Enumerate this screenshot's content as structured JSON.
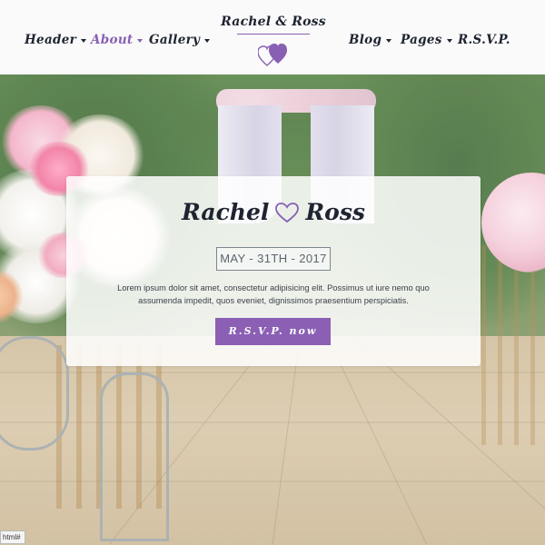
{
  "header": {
    "nav_left": [
      {
        "label": "Header",
        "active": false
      },
      {
        "label": "About",
        "active": true
      },
      {
        "label": "Gallery",
        "active": false
      }
    ],
    "nav_right": [
      {
        "label": "Blog"
      },
      {
        "label": "Pages"
      },
      {
        "label": "R.S.V.P."
      }
    ],
    "brand": "Rachel & Ross",
    "brand_icon": "double-heart-icon"
  },
  "hero": {
    "bride": "Rachel",
    "groom": "Ross",
    "heart_icon": "heart-outline-icon",
    "date": "MAY - 31TH - 2017",
    "description": "Lorem ipsum dolor sit amet, consectetur adipisicing elit. Possimus ut iure nemo quo assumenda impedit, quos eveniet, dignissimos praesentium perspiciatis.",
    "button_label": "R.S.V.P. now"
  },
  "status_bar": {
    "text": "html#"
  },
  "colors": {
    "accent": "#8860b3",
    "button": "#8a5fb4",
    "text_dark": "#1e2430",
    "header_bg": "#fafafa"
  }
}
